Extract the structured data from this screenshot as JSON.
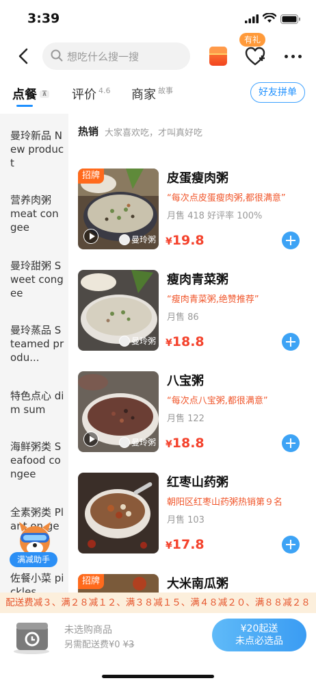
{
  "status_bar": {
    "time": "3:39"
  },
  "nav": {
    "search_placeholder": "想吃什么搜一搜",
    "gift_badge": "有礼"
  },
  "tabs": [
    {
      "label": "点餐",
      "badge": ""
    },
    {
      "label": "评价",
      "sup": "4.6"
    },
    {
      "label": "商家",
      "sup": "故事"
    }
  ],
  "group_order_label": "好友拼单",
  "sidebar": {
    "items": [
      {
        "label": "曼玲新品 New product"
      },
      {
        "label": "营养肉粥 meat congee"
      },
      {
        "label": "曼玲甜粥 Sweet congee"
      },
      {
        "label": "曼玲蒸品 Steamed produ..."
      },
      {
        "label": "特色点心 dim sum"
      },
      {
        "label": "海鲜粥类 Seafood congee"
      },
      {
        "label": "全素粥类 Plant on ge"
      },
      {
        "label": "佐餐小菜 pickles"
      }
    ],
    "helper_label": "满减助手"
  },
  "section": {
    "title": "热销",
    "subtitle": "大家喜欢吃，才叫真好吃"
  },
  "dishes": [
    {
      "name": "皮蛋瘦肉粥",
      "tag": "招牌",
      "note": "“每次点皮蛋瘦肉粥,都很满意”",
      "sales": "月售 418  好评率 100%",
      "currency": "¥",
      "price": "19.8",
      "brand": "曼玲粥"
    },
    {
      "name": "瘦肉青菜粥",
      "tag": "",
      "note": "“瘦肉青菜粥,绝赞推荐”",
      "sales": "月售 86",
      "currency": "¥",
      "price": "18.8",
      "brand": "曼玲粥"
    },
    {
      "name": "八宝粥",
      "tag": "",
      "note": "“每次点八宝粥,都很满意”",
      "sales": "月售 122",
      "currency": "¥",
      "price": "18.8",
      "brand": "曼玲粥"
    },
    {
      "name": "红枣山药粥",
      "tag": "",
      "note": "朝阳区红枣山药粥热销第９名",
      "sales": "月售 103",
      "currency": "¥",
      "price": "17.8",
      "brand": ""
    },
    {
      "name": "大米南瓜粥",
      "tag": "招牌",
      "note": "",
      "sales": "",
      "currency": "",
      "price": "",
      "brand": ""
    }
  ],
  "promo": "配送费减３、满２８减１２、满３８减１５、满４８减２０、满８８减２８",
  "cart": {
    "title": "未选购商品",
    "delivery_prefix": "另需配送费",
    "delivery_fee": "¥0",
    "delivery_original": "¥3",
    "checkout_line1": "¥20起送",
    "checkout_line2": "未点必选品"
  },
  "colors": {
    "accent": "#1e90ff",
    "price": "#f4422c",
    "promo_bg": "#fcefdc",
    "tag": "#ff6a1c"
  }
}
